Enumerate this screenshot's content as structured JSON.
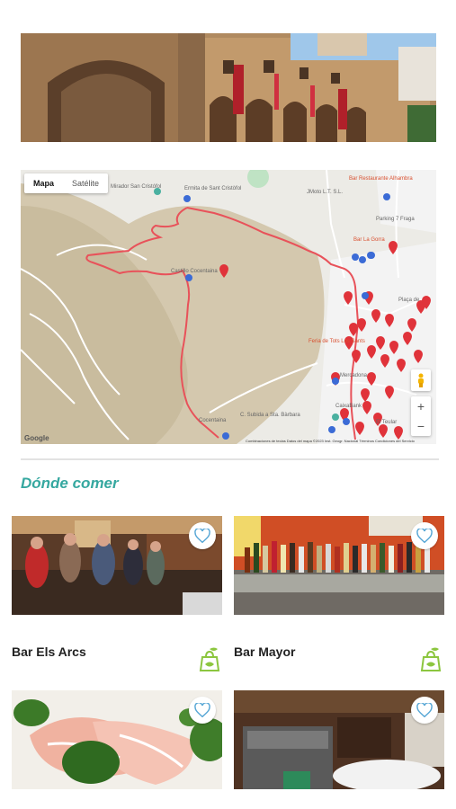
{
  "map": {
    "toggle_map": "Mapa",
    "toggle_satellite": "Satélite",
    "google": "Google",
    "footer": "Combinaciones de teclas   Datos del mapa ©2023 Inst. Geogr. Nacional   Términos   Condiciones del Servicio",
    "zoom_in": "+",
    "zoom_out": "−",
    "labels": {
      "ermita": "Ermita de Sant Cristòfol",
      "mirador": "Mirador San Cristófol",
      "castillo": "Castillo Cocentaina",
      "bar_restaurante": "Bar Restaurante Alhambra",
      "parking": "Parking 7 Fraga",
      "bar_la_gorra": "Bar La Gorra",
      "jmoto": "JMoto L.T. S.L.",
      "placa": "Plaça de",
      "feria": "Feria de Tots Los Sants",
      "mercadona": "Mercadona",
      "caixabank": "CaixaBank",
      "el_teular": "El Teular",
      "calle": "C. Subida a Sta. Bàrbara",
      "cocentaina": "Cocentaina"
    }
  },
  "section": {
    "title": "Dónde comer"
  },
  "cards": [
    {
      "name": "Bar Els Arcs"
    },
    {
      "name": "Bar Mayor"
    }
  ],
  "colors": {
    "accent": "#36a8a0",
    "eco": "#8cc63f",
    "route": "#e8525a",
    "pin": "#e0333a"
  }
}
